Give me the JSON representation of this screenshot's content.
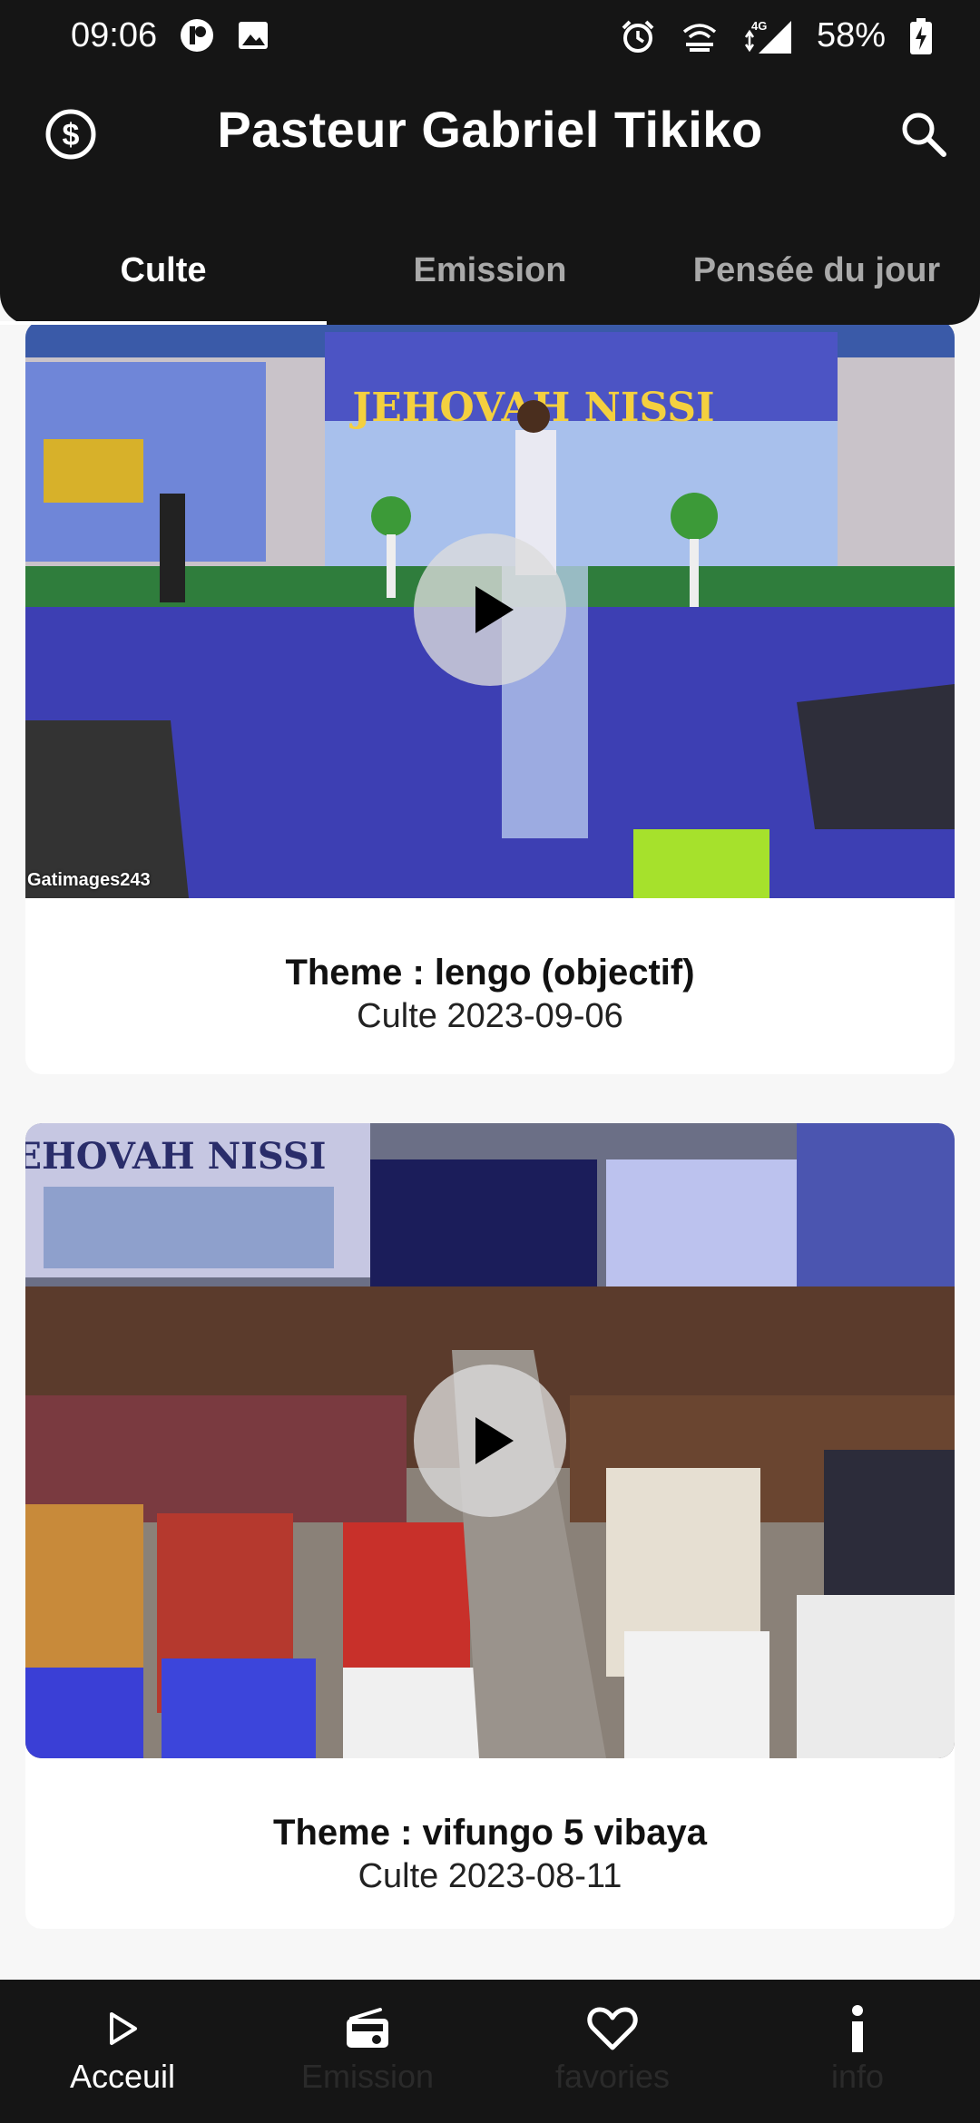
{
  "status_bar": {
    "time": "09:06",
    "battery": "58%",
    "network": "4G"
  },
  "app_bar": {
    "title": "Pasteur Gabriel Tikiko",
    "left_icon": "dollar-circle-icon",
    "right_icon": "search-icon"
  },
  "tabs": [
    {
      "label": "Culte",
      "active": true
    },
    {
      "label": "Emission",
      "active": false
    },
    {
      "label": "Pensée du jour",
      "active": false
    }
  ],
  "cards": [
    {
      "theme": "Theme : lengo (objectif)",
      "date": "Culte 2023-09-06",
      "banner_text": "JEHOVAH NISSI",
      "watermark": "Gatimages243"
    },
    {
      "theme": "Theme : vifungo 5 vibaya",
      "date": "Culte 2023-08-11",
      "banner_text": "JEHOVAH NISSI",
      "watermark": ""
    }
  ],
  "bottom_nav": [
    {
      "label": "Acceuil",
      "icon": "play-outline-icon",
      "active": true
    },
    {
      "label": "Emission",
      "icon": "radio-icon",
      "active": false
    },
    {
      "label": "favories",
      "icon": "heart-icon",
      "active": false
    },
    {
      "label": "info",
      "icon": "info-icon",
      "active": false
    }
  ],
  "colors": {
    "bar_background": "#151515",
    "page_background": "#f7f7f7",
    "card_background": "#ffffff",
    "tab_inactive": "#a9a9a9"
  }
}
